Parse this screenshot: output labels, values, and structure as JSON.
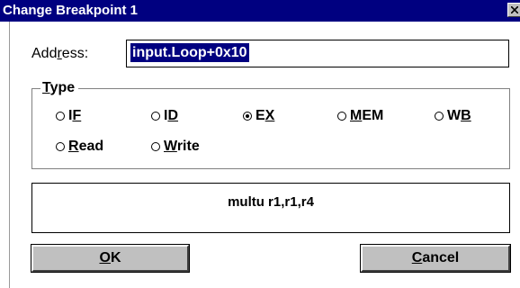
{
  "window": {
    "title": "Change Breakpoint 1"
  },
  "address": {
    "label_pre": "Add",
    "label_mnemonic": "r",
    "label_post": "ess:",
    "value": "input.Loop+0x10"
  },
  "type_group": {
    "label_mnemonic": "T",
    "label_post": "ype",
    "options": [
      {
        "label_pre": "I",
        "label_mnemonic": "F",
        "label_post": "",
        "checked": false
      },
      {
        "label_pre": "I",
        "label_mnemonic": "D",
        "label_post": "",
        "checked": false
      },
      {
        "label_pre": "E",
        "label_mnemonic": "X",
        "label_post": "",
        "checked": true
      },
      {
        "label_pre": "",
        "label_mnemonic": "M",
        "label_post": "EM",
        "checked": false
      },
      {
        "label_pre": "W",
        "label_mnemonic": "B",
        "label_post": "",
        "checked": false
      },
      {
        "label_pre": "",
        "label_mnemonic": "R",
        "label_post": "ead",
        "checked": false
      },
      {
        "label_pre": "",
        "label_mnemonic": "W",
        "label_post": "rite",
        "checked": false
      }
    ]
  },
  "instruction": {
    "text": "multu r1,r1,r4"
  },
  "buttons": {
    "ok_mnemonic": "O",
    "ok_post": "K",
    "cancel_mnemonic": "C",
    "cancel_post": "ancel"
  },
  "colors": {
    "titlebar": "#000080",
    "button_face": "#c0c0c0",
    "selection": "#000080"
  },
  "icons": {
    "close": "close-icon"
  }
}
